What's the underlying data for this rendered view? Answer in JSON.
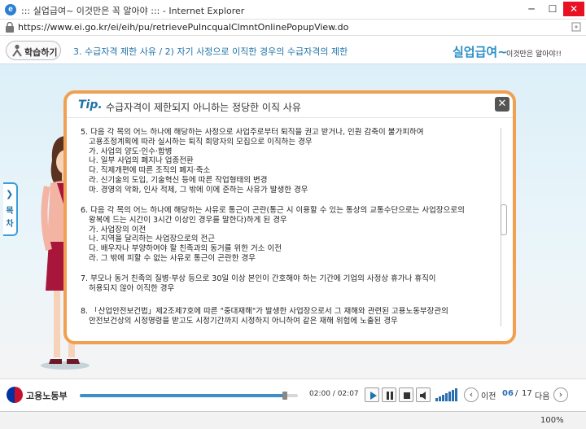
{
  "window": {
    "title": "::: 실업급여~ 이것만은 꼭 알아야 ::: - Internet Explorer",
    "url": "https://www.ei.go.kr/ei/eih/pu/retrievePuIncqualClmntOnlinePopupView.do",
    "minimize": "─",
    "maximize": "☐",
    "close": "✕"
  },
  "header": {
    "learn_label": "학습하기",
    "breadcrumb": "3. 수급자격 제한 사유 / 2) 자기 사정으로 이직한 경우의 수급자격의 제한",
    "logo_main": "실업급여~",
    "logo_sub": "이것만은 알아야!!"
  },
  "toc": {
    "chars": [
      "목",
      "차"
    ]
  },
  "modal": {
    "tip": "Tip.",
    "title": "수급자격이 제한되지 아니하는 정당한 이직 사유",
    "close": "✕",
    "sections": [
      {
        "lines": [
          "5. 다음 각 목의 어느 하나에 해당하는 사정으로 사업주로부터 퇴직을 권고 받거나, 인원 감축이 불가피하여",
          "고용조정계획에 따라 실시하는 퇴직 희망자의 모집으로 이직하는 경우",
          "가. 사업의 양도·인수·합병",
          "나. 일부 사업의 폐지나 업종전환",
          "다. 직제개편에 따른 조직의 폐지·축소",
          "라. 신기술의 도입, 기술혁신 등에 따른 작업형태의 변경",
          "마. 경영의 악화, 인사 적체, 그 밖에 이에 준하는 사유가 발생한 경우"
        ]
      },
      {
        "lines": [
          "6. 다음 각 목의 어느 하나에 해당하는 사유로 통근이 곤란(통근 시 이용할 수 있는 통상의 교통수단으로는 사업장으로의",
          "왕복에 드는 시간이 3시간 이상인 경우를 말한다)하게 된 경우",
          "가. 사업장의 이전",
          "나. 지역을 달리하는 사업장으로의 전근",
          "다. 배우자나 부양하여야 할 친족과의 동거를 위한 거소 이전",
          "라. 그 밖에 피할 수 없는 사유로 통근이 곤란한 경우"
        ]
      },
      {
        "lines": [
          "7. 부모나 동거 친족의 질병·부상 등으로 30일 이상 본인이 간호해야 하는 기간에 기업의 사정상 휴가나  휴직이",
          "허용되지 않아 이직한 경우"
        ]
      },
      {
        "lines": [
          "8. 「산업안전보건법」제2조제7호에 따른 \"중대재해\"가 발생한 사업장으로서 그 재해와 관련된  고용노동부장관의",
          "안전보건상의 시정명령을 받고도 시정기간까지 시정하지 아니하여 같은 재해 위험에  노출된 경우"
        ]
      }
    ]
  },
  "player": {
    "ministry": "고용노동부",
    "current_time": "02:00",
    "total_time": "02:07",
    "progress": 0.94,
    "prev_label": "이전",
    "next_label": "다음",
    "page_current": "06",
    "page_total": "17",
    "page_sep": "/"
  },
  "status": {
    "zoom": "100%"
  },
  "colors": {
    "accent": "#1f73a8",
    "modal_border": "#f0a050",
    "progress": "#3c8fc8"
  }
}
